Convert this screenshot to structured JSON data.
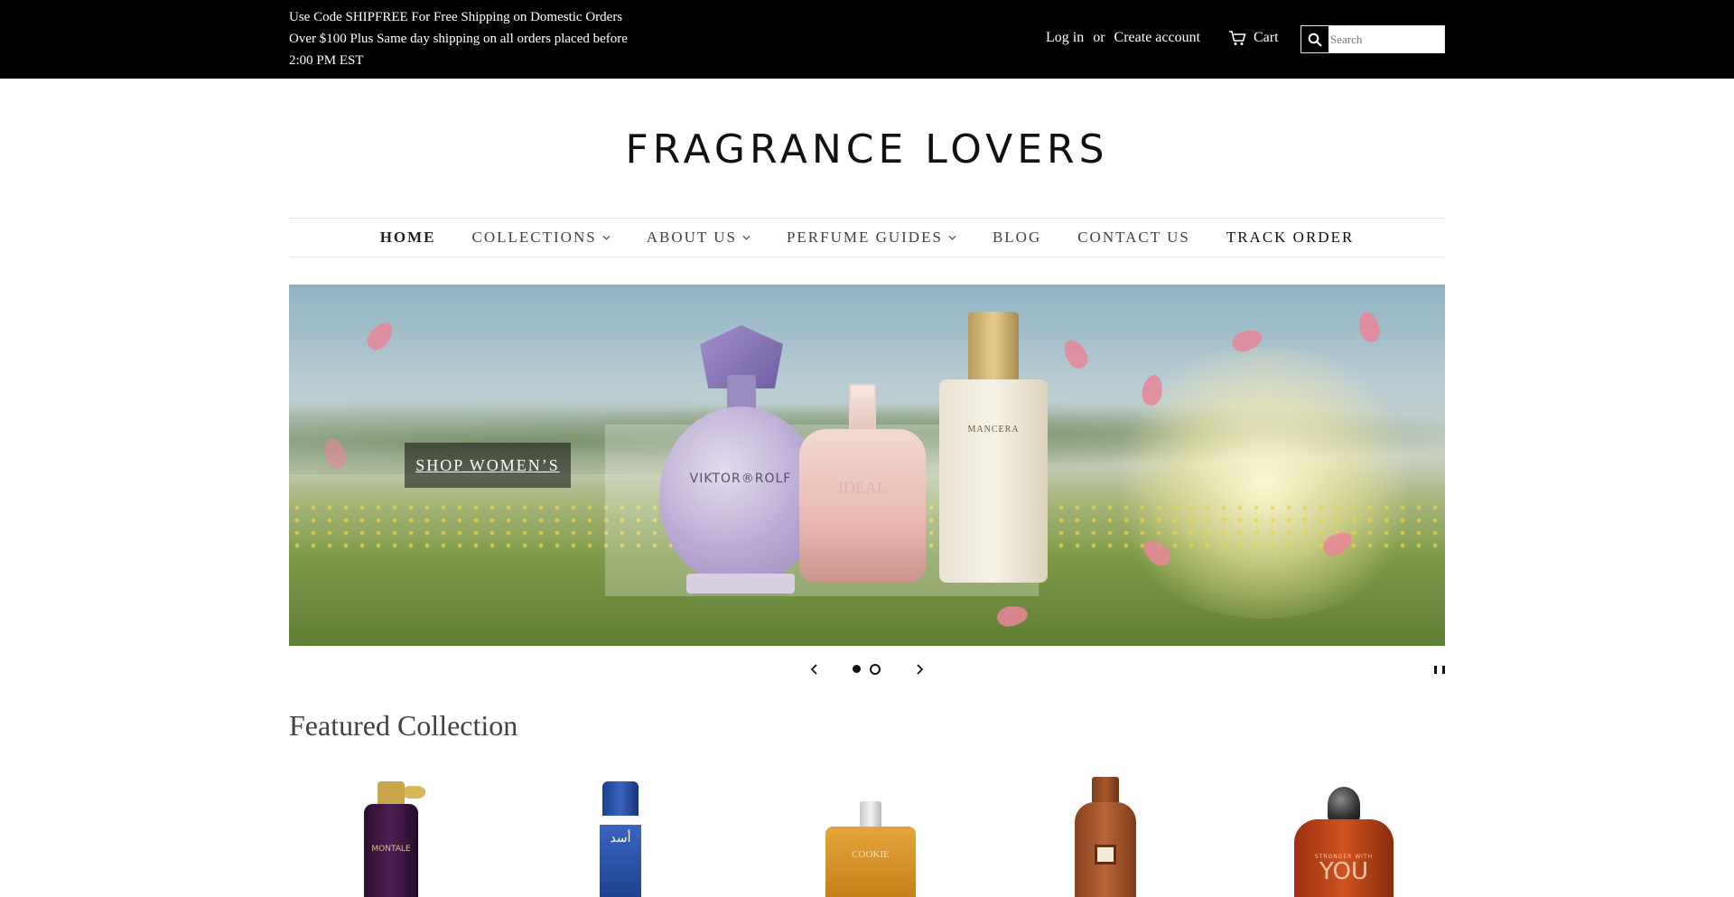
{
  "announcement": {
    "lines": [
      "Use Code SHIPFREE For Free Shipping on Domestic Orders",
      "Over $100 Plus Same day shipping on all orders placed before",
      "2:00 PM EST"
    ]
  },
  "header": {
    "login_label": "Log in",
    "or_label": "or",
    "create_account_label": "Create account",
    "cart_label": "Cart",
    "search_placeholder": "Search",
    "icons": {
      "cart": "cart-icon",
      "search": "search-icon"
    }
  },
  "logo": {
    "text": "FRAGRANCE LOVERS"
  },
  "nav": {
    "items": [
      {
        "label": "HOME",
        "dropdown": false
      },
      {
        "label": "COLLECTIONS",
        "dropdown": true
      },
      {
        "label": "ABOUT US",
        "dropdown": true
      },
      {
        "label": "PERFUME GUIDES",
        "dropdown": true
      },
      {
        "label": "BLOG",
        "dropdown": false
      },
      {
        "label": "CONTACT US",
        "dropdown": false
      },
      {
        "label": "TRACK ORDER",
        "dropdown": false
      }
    ],
    "active": "HOME"
  },
  "hero": {
    "cta_label": "SHOP WOMEN’S",
    "bottle_labels": {
      "left": "VIKTOR®ROLF",
      "middle": "IDEAL",
      "right": "MANCERA"
    },
    "slides_total": 2,
    "current_slide": 1
  },
  "featured": {
    "title": "Featured Collection",
    "products": [
      {
        "label": "MONTALE"
      },
      {
        "label": "أسد"
      },
      {
        "label": "COOKIE"
      },
      {
        "label": ""
      },
      {
        "label": "YOU",
        "sublabel": "STRONGER WITH"
      }
    ]
  },
  "colors": {
    "topbar_bg": "#000000",
    "text": "#3d4246",
    "border": "#e8e9eb",
    "cta_overlay": "rgba(0,0,0,0.5)"
  }
}
